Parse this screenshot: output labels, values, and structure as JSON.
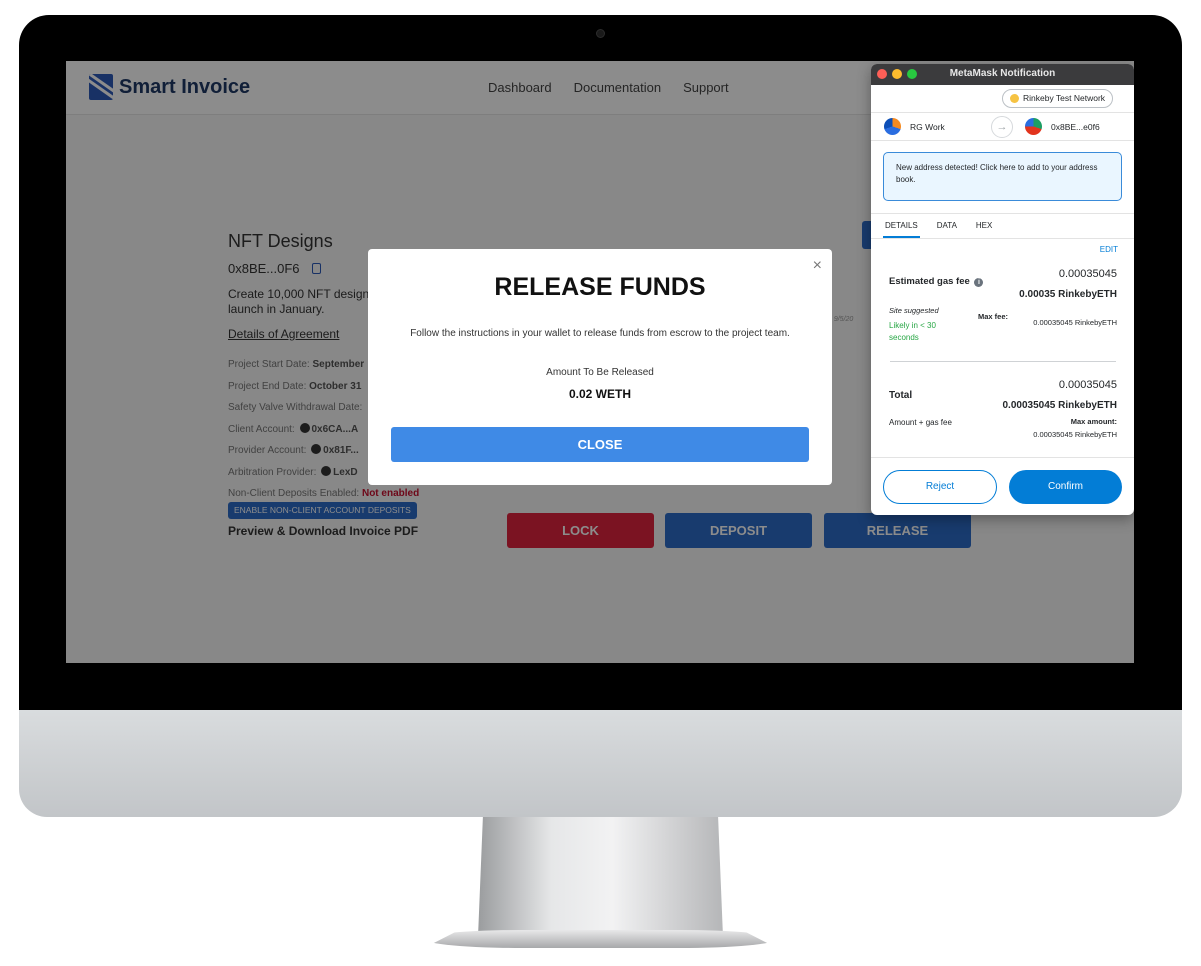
{
  "app": {
    "brand": "Smart Invoice",
    "nav": [
      "Dashboard",
      "Documentation",
      "Support"
    ]
  },
  "invoice": {
    "title": "NFT Designs",
    "address": "0x8BE...0F6",
    "description": "Create 10,000 NFT designs launch in January.",
    "details_link": "Details of Agreement",
    "start_label": "Project Start Date:",
    "start_value": "September",
    "end_label": "Project End Date:",
    "end_value": "October 31",
    "safety_label": "Safety Valve Withdrawal Date:",
    "client_label": "Client Account:",
    "client_value": "0x6CA...A",
    "provider_label": "Provider Account:",
    "provider_value": "0x81F...",
    "arbitration_label": "Arbitration Provider:",
    "arbitration_value": "LexD",
    "deposits_label": "Non-Client Deposits Enabled:",
    "deposits_value": "Not enabled",
    "enable_button": "ENABLE NON-CLIENT ACCOUNT DEPOSITS",
    "pdf_link": "Preview & Download Invoice PDF",
    "side_date": "d 9/5/20",
    "buttons": {
      "lock": "LOCK",
      "deposit": "DEPOSIT",
      "release": "RELEASE"
    }
  },
  "modal": {
    "close_icon": "×",
    "title": "RELEASE FUNDS",
    "text": "Follow the instructions in your wallet to release funds from escrow to the project team.",
    "amount_label": "Amount To Be Released",
    "amount": "0.02 WETH",
    "button": "CLOSE"
  },
  "metamask": {
    "window_title": "MetaMask Notification",
    "network": "Rinkeby Test Network",
    "from_account": "RG Work",
    "to_account": "0x8BE...e0f6",
    "arrow_icon": "→",
    "alert": "New address detected! Click here to add to your address book.",
    "tabs": [
      "DETAILS",
      "DATA",
      "HEX"
    ],
    "edit": "EDIT",
    "gas_label": "Estimated gas fee",
    "gas_value": "0.00035045",
    "gas_value_eth": "0.00035 RinkebyETH",
    "site_suggested": "Site suggested",
    "likely": "Likely in < 30 seconds",
    "max_fee_label": "Max fee:",
    "max_fee_value": "0.00035045 RinkebyETH",
    "total_label": "Total",
    "total_value": "0.00035045",
    "total_value_eth": "0.00035045 RinkebyETH",
    "amount_gas_label": "Amount + gas fee",
    "max_amount_label": "Max amount:",
    "max_amount_value": "0.00035045 RinkebyETH",
    "reject": "Reject",
    "confirm": "Confirm",
    "colors": {
      "accent": "#037dd6",
      "green": "#28a745"
    }
  }
}
